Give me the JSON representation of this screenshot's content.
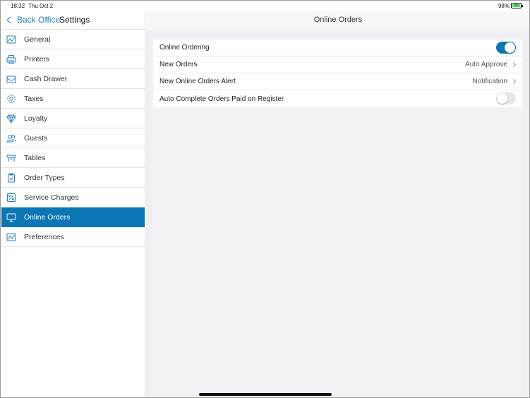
{
  "status_bar": {
    "time": "18:32",
    "date": "Thu Oct 2",
    "battery": "98%"
  },
  "sidebar": {
    "back_label": "Back Office",
    "title": "Settings",
    "items": [
      {
        "label": "General",
        "icon": "chart-icon"
      },
      {
        "label": "Printers",
        "icon": "printer-icon"
      },
      {
        "label": "Cash Drawer",
        "icon": "cash-drawer-icon"
      },
      {
        "label": "Taxes",
        "icon": "gear-icon"
      },
      {
        "label": "Loyalty",
        "icon": "diamond-icon"
      },
      {
        "label": "Guests",
        "icon": "users-icon"
      },
      {
        "label": "Tables",
        "icon": "table-icon"
      },
      {
        "label": "Order Types",
        "icon": "clipboard-icon"
      },
      {
        "label": "Service Charges",
        "icon": "percent-icon"
      },
      {
        "label": "Online Orders",
        "icon": "monitor-icon",
        "active": true
      },
      {
        "label": "Preferences",
        "icon": "chart-icon"
      }
    ]
  },
  "main": {
    "title": "Online Orders",
    "rows": [
      {
        "label": "Online Ordering",
        "toggle": true
      },
      {
        "label": "New Orders",
        "value": "Auto Approve"
      },
      {
        "label": "New Online Orders Alert",
        "value": "Notification"
      },
      {
        "label": "Auto Complete Orders Paid on Register",
        "toggle": false
      }
    ]
  },
  "colors": {
    "accent": "#0c76b5",
    "link": "#1e7fc4",
    "background": "#efeff4"
  }
}
